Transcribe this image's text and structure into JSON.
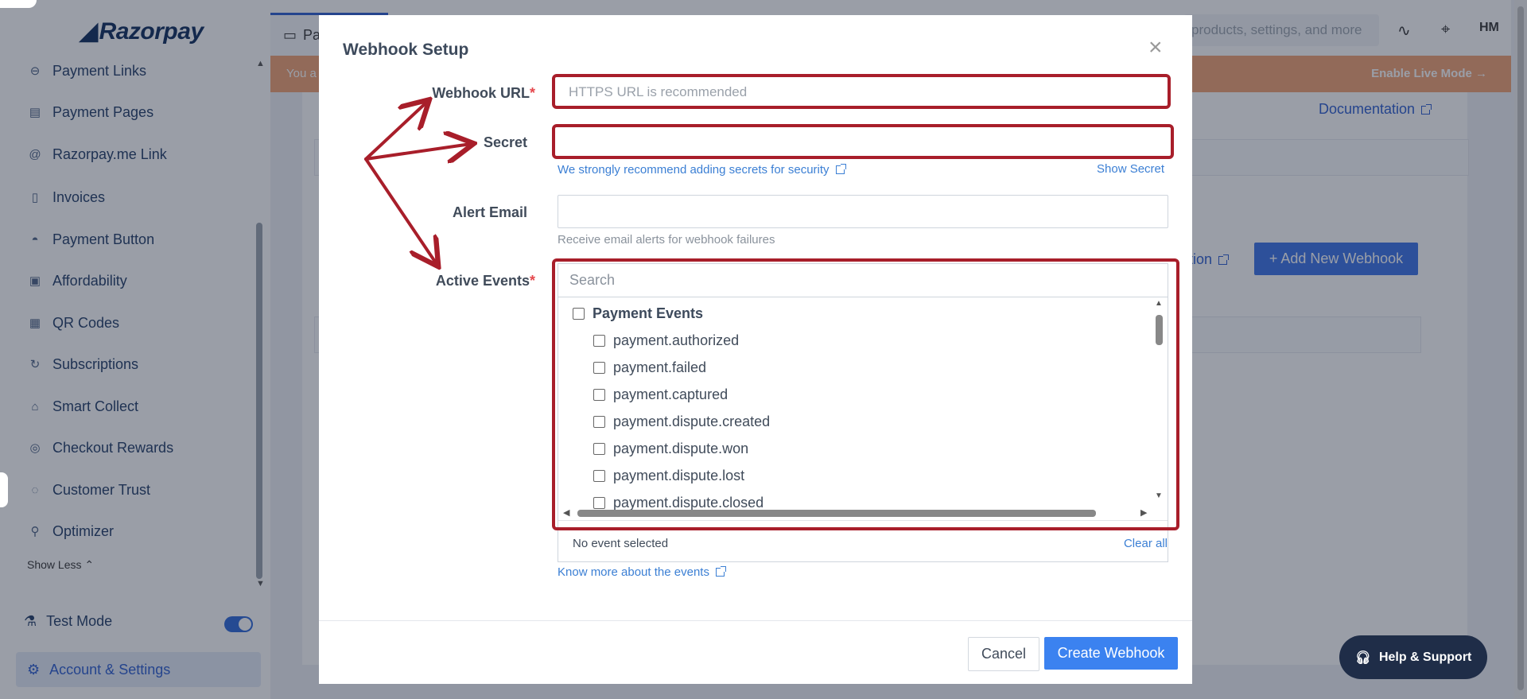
{
  "app": {
    "brand": "Razorpay"
  },
  "sidebar": {
    "items": [
      {
        "label": "Payment Links",
        "icon": "link-icon"
      },
      {
        "label": "Payment Pages",
        "icon": "page-icon"
      },
      {
        "label": "Razorpay.me Link",
        "icon": "at-icon"
      },
      {
        "label": "Invoices",
        "icon": "invoice-icon"
      },
      {
        "label": "Payment Button",
        "icon": "button-icon"
      },
      {
        "label": "Affordability",
        "icon": "affordability-icon"
      },
      {
        "label": "QR Codes",
        "icon": "qr-icon"
      },
      {
        "label": "Subscriptions",
        "icon": "refresh-icon"
      },
      {
        "label": "Smart Collect",
        "icon": "bank-icon"
      },
      {
        "label": "Checkout Rewards",
        "icon": "reward-icon"
      },
      {
        "label": "Customer Trust",
        "icon": "trust-icon"
      },
      {
        "label": "Optimizer",
        "icon": "optimizer-icon"
      }
    ],
    "show_less": "Show Less",
    "test_mode": "Test Mode",
    "account_settings": "Account & Settings"
  },
  "topbar": {
    "tab_label": "Pa",
    "search_placeholder": "products, settings, and more",
    "avatar": "HM"
  },
  "banner": {
    "left_text": "You a",
    "right_text": "Enable Live Mode →"
  },
  "page": {
    "documentation": "Documentation",
    "partial_link": "tion",
    "add_webhook": "+ Add New Webhook"
  },
  "help": {
    "label": "Help & Support"
  },
  "modal": {
    "title": "Webhook Setup",
    "close": "×",
    "webhook_url_label": "Webhook URL",
    "webhook_url_placeholder": "HTTPS URL is recommended",
    "webhook_url_value": "",
    "secret_label": "Secret",
    "secret_value": "",
    "secret_hint": "We strongly recommend adding secrets for security",
    "show_secret": "Show Secret",
    "alert_email_label": "Alert Email",
    "alert_email_value": "",
    "alert_email_hint": "Receive email alerts for webhook failures",
    "active_events_label": "Active Events",
    "events_search_placeholder": "Search",
    "event_group": "Payment Events",
    "events": [
      "payment.authorized",
      "payment.failed",
      "payment.captured",
      "payment.dispute.created",
      "payment.dispute.won",
      "payment.dispute.lost",
      "payment.dispute.closed"
    ],
    "selected_status": "No event selected",
    "clear_all": "Clear all",
    "know_more": "Know more about the events",
    "cancel": "Cancel",
    "create": "Create Webhook",
    "required_mark": "*"
  },
  "colors": {
    "accent": "#3b82f0",
    "annotation": "#a81e2a",
    "required": "#e5484d",
    "banner": "#f0a071"
  }
}
